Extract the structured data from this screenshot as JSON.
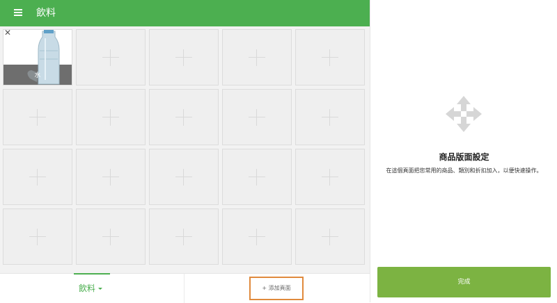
{
  "header": {
    "title": "飲料",
    "menu_icon": "menu-icon"
  },
  "grid": {
    "product": {
      "name": "水"
    },
    "empty_tiles": 19
  },
  "bottom": {
    "category_label": "飲料",
    "add_page_label": "+ 添加頁面"
  },
  "settings": {
    "title": "商品版面設定",
    "description": "在這個頁面把您常用的商品、類別和折扣加入，以便快速操作。",
    "done_label": "完成"
  },
  "colors": {
    "accent": "#4caf50",
    "done": "#7cb342",
    "highlight": "#e08a3c"
  }
}
